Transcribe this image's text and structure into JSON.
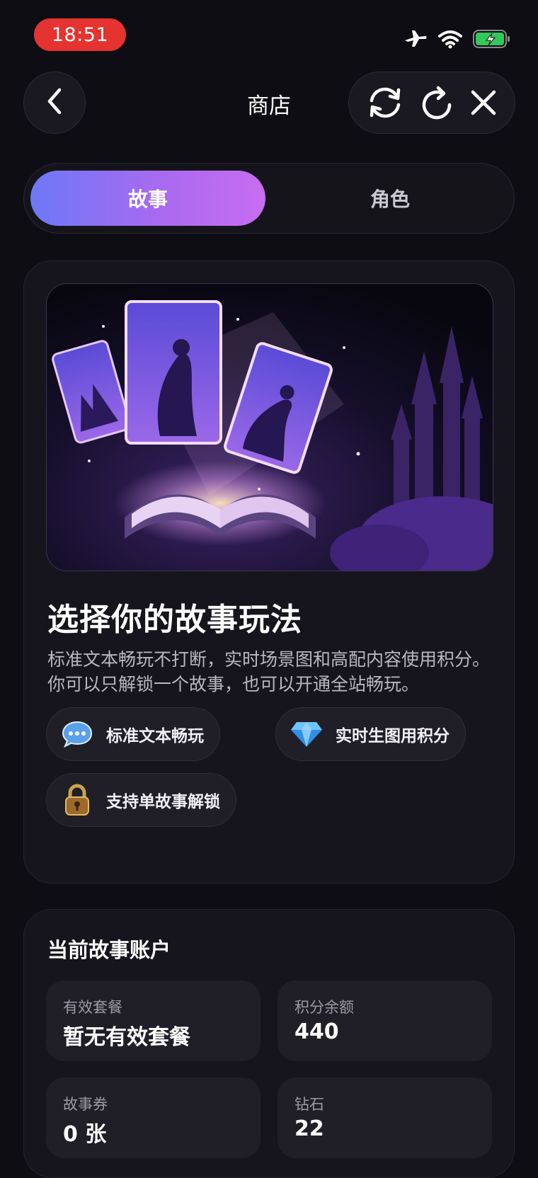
{
  "status_bar": {
    "time": "18:51",
    "icons": [
      "airplane-icon",
      "wifi-icon",
      "battery-charging-icon"
    ]
  },
  "header": {
    "title": "商店",
    "back_icon": "chevron-left-icon",
    "actions": [
      "sync-icon",
      "refresh-icon",
      "close-icon"
    ]
  },
  "tabs": [
    {
      "label": "故事",
      "active": true
    },
    {
      "label": "角色",
      "active": false
    }
  ],
  "hero": {
    "image_icon": "story-cards-illustration",
    "title": "选择你的故事玩法",
    "description": "标准文本畅玩不打断，实时场景图和高配内容使用积分。你可以只解锁一个故事，也可以开通全站畅玩。",
    "features": [
      {
        "label": "标准文本畅玩",
        "icon": "speech-bubble-icon"
      },
      {
        "label": "实时生图用积分",
        "icon": "diamond-icon"
      },
      {
        "label": "支持单故事解锁",
        "icon": "lock-icon"
      }
    ]
  },
  "account": {
    "title": "当前故事账户",
    "stats": [
      {
        "label": "有效套餐",
        "value": "暂无有效套餐"
      },
      {
        "label": "积分余额",
        "value": "440"
      },
      {
        "label": "故事券",
        "value": "0 张"
      },
      {
        "label": "钻石",
        "value": "22"
      }
    ]
  },
  "colors": {
    "background": "#0e0d14",
    "card": "#16151d",
    "tab_gradient_start": "#6d78f7",
    "tab_gradient_end": "#c86df0",
    "time_pill": "#e5332f",
    "battery": "#34c759"
  }
}
